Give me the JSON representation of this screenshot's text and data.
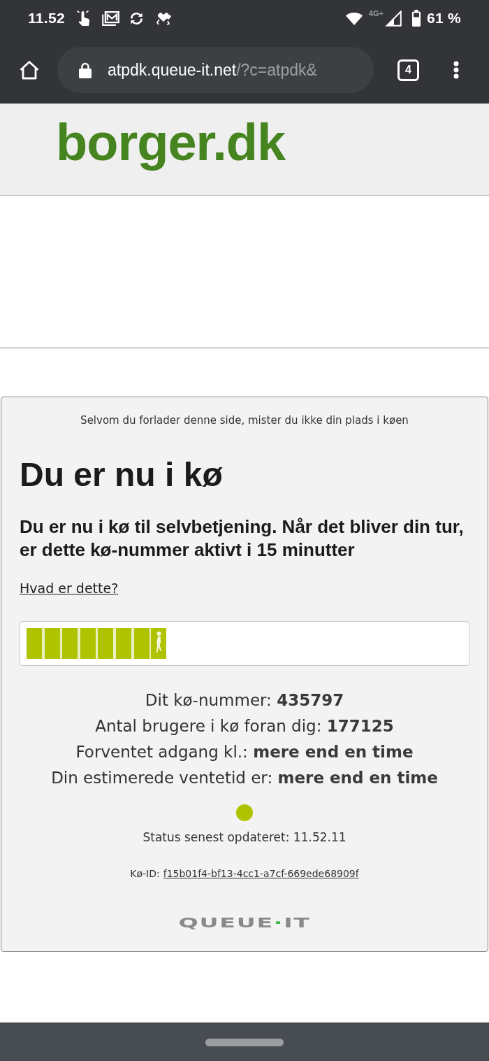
{
  "status_bar": {
    "time": "11.52",
    "network": "4G+",
    "battery": "61 %"
  },
  "browser": {
    "url": {
      "host": "atpdk.queue-it.net",
      "path": "/?c=atpdk&"
    },
    "tab_count": "4"
  },
  "header": {
    "logo": "borger.dk"
  },
  "queue": {
    "notice": "Selvom du forlader denne side, mister du ikke din plads i køen",
    "title": "Du er nu i kø",
    "subtitle": "Du er nu i kø til selvbetjening. Når det bliver din tur, er dette kø-nummer aktivt i 15 minutter",
    "help_link": "Hvad er dette?",
    "progress": {
      "level": 0.32
    },
    "info": [
      {
        "label": "Dit kø-nummer:",
        "value": "435797"
      },
      {
        "label": "Antal brugere i kø foran dig:",
        "value": "177125"
      },
      {
        "label": "Forventet adgang kl.:",
        "value": "mere end en time"
      },
      {
        "label": "Din estimerede ventetid er:",
        "value": "mere end en time"
      }
    ],
    "status_text": "Status senest opdateret: 11.52.11",
    "queue_id": {
      "label": "Kø-ID:",
      "value": "f15b01f4-bf13-4cc1-a7cf-669ede68909f"
    },
    "footer_logo": {
      "before": "QUEUE",
      "separator": "·",
      "after": "IT"
    }
  }
}
